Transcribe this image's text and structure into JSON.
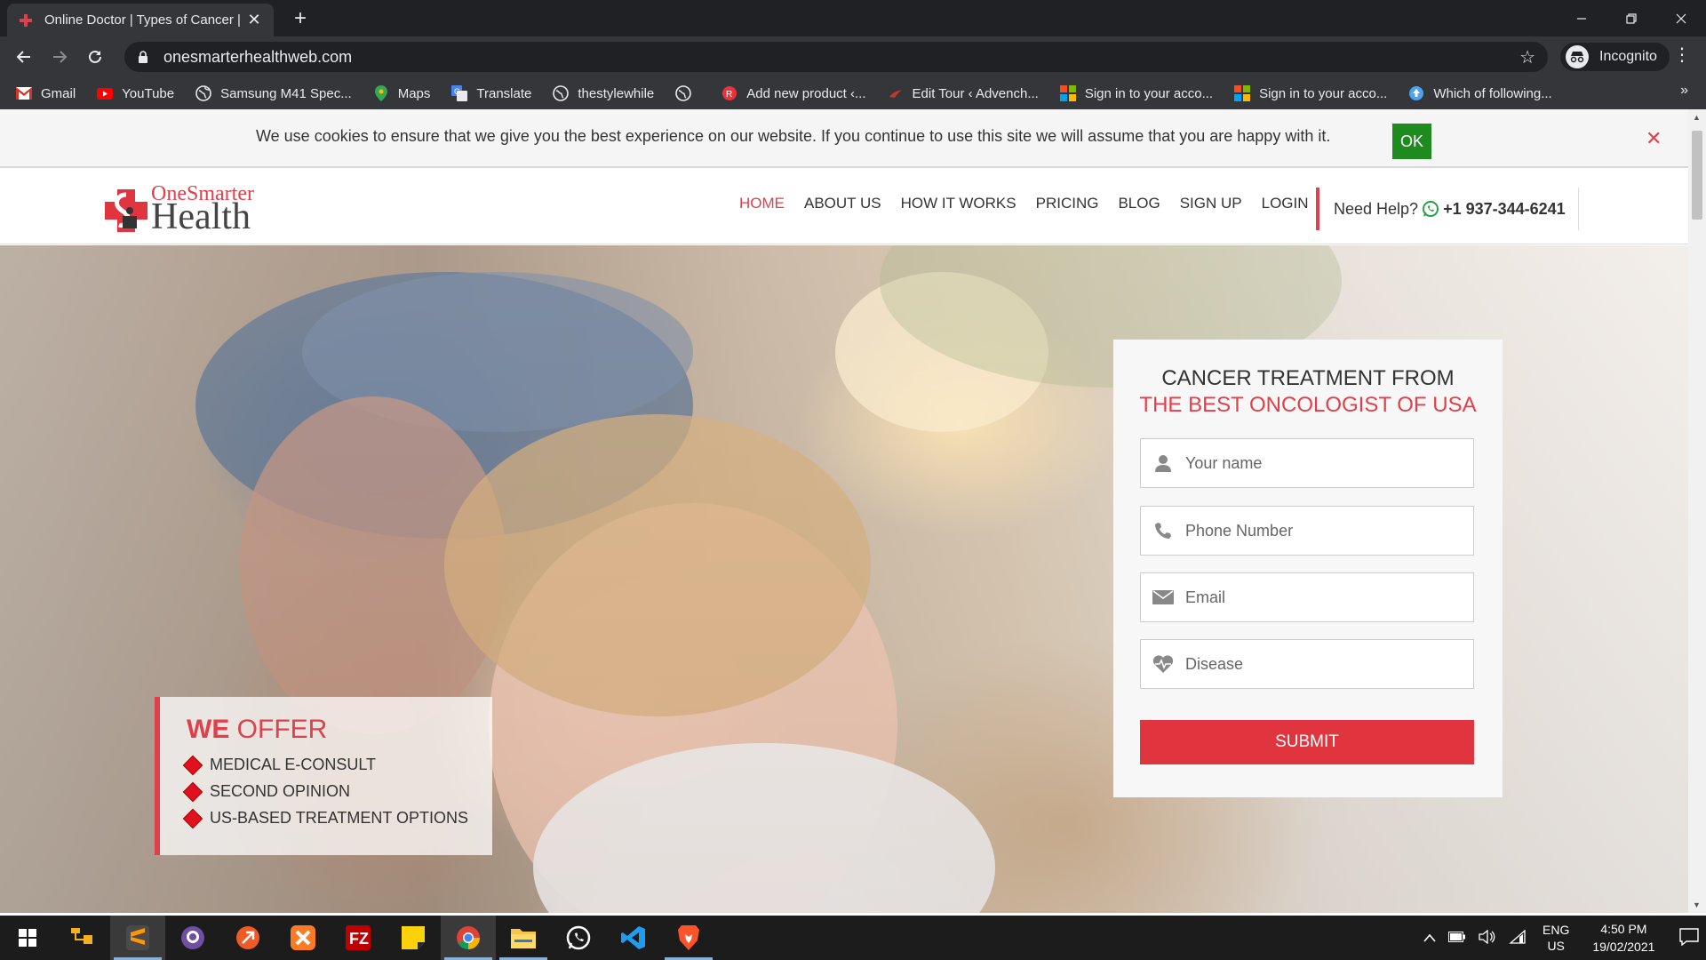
{
  "browser": {
    "tab_title": "Online Doctor | Types of Cancer |",
    "url": "onesmarterhealthweb.com",
    "incognito_label": "Incognito",
    "new_tab": "+",
    "tab_close": "✕",
    "more_bookmarks": "»",
    "bookmarks": [
      {
        "label": "Gmail",
        "icon": "gmail-icon"
      },
      {
        "label": "YouTube",
        "icon": "youtube-icon"
      },
      {
        "label": "Samsung M41 Spec...",
        "icon": "globe-icon"
      },
      {
        "label": "Maps",
        "icon": "maps-icon"
      },
      {
        "label": "Translate",
        "icon": "translate-icon"
      },
      {
        "label": "thestylewhile",
        "icon": "globe-icon"
      },
      {
        "label": "",
        "icon": "globe-icon"
      },
      {
        "label": "Add new product ‹...",
        "icon": "site-icon"
      },
      {
        "label": "Edit Tour ‹ Advench...",
        "icon": "site-icon"
      },
      {
        "label": "Sign in to your acco...",
        "icon": "microsoft-icon"
      },
      {
        "label": "Sign in to your acco...",
        "icon": "microsoft-icon"
      },
      {
        "label": "Which of following...",
        "icon": "upload-icon"
      }
    ]
  },
  "cookie": {
    "message": "We use cookies to ensure that we give you the best experience on our website. If you continue to use this site we will assume that you are happy with it.",
    "ok_label": "OK",
    "close": "✕"
  },
  "site": {
    "logo_top": "OneSmarter",
    "logo_bottom": "Health",
    "nav": [
      "HOME",
      "ABOUT US",
      "HOW IT WORKS",
      "PRICING",
      "BLOG",
      "SIGN UP",
      "LOGIN"
    ],
    "help_label": "Need Help?",
    "help_phone": "+1 937-344-6241"
  },
  "offer": {
    "title_bold": "WE",
    "title_rest": " OFFER",
    "items": [
      "MEDICAL E-CONSULT",
      "SECOND OPINION",
      "US-BASED TREATMENT OPTIONS"
    ]
  },
  "form": {
    "heading1": "CANCER TREATMENT FROM",
    "heading2": "THE BEST ONCOLOGIST OF USA",
    "name_placeholder": "Your name",
    "phone_placeholder": "Phone Number",
    "email_placeholder": "Email",
    "disease_placeholder": "Disease",
    "submit_label": "SUBMIT"
  },
  "taskbar": {
    "lang_top": "ENG",
    "lang_bottom": "US",
    "time": "4:50 PM",
    "date": "19/02/2021"
  },
  "colors": {
    "accent": "#e0404b",
    "ok_green": "#1e8b1e",
    "chrome_dark": "#202124"
  }
}
